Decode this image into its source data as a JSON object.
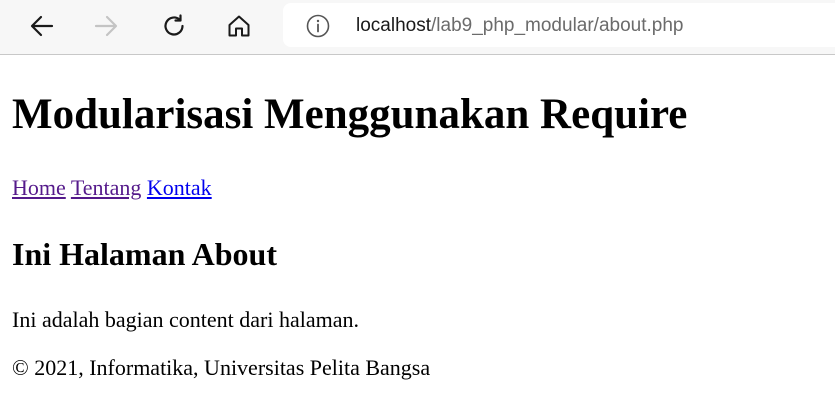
{
  "browser": {
    "icons": {
      "back": "arrow-left-icon",
      "forward": "arrow-right-icon",
      "reload": "reload-icon",
      "home": "home-icon",
      "site_info": "info-circle-icon"
    },
    "address": {
      "host": "localhost",
      "path": "/lab9_php_modular/about.php"
    }
  },
  "page": {
    "title": "Modularisasi Menggunakan Require",
    "nav": [
      {
        "label": "Home",
        "visited": true
      },
      {
        "label": "Tentang",
        "visited": true
      },
      {
        "label": "Kontak",
        "visited": false
      }
    ],
    "heading": "Ini Halaman About",
    "content": "Ini adalah bagian content dari halaman.",
    "footer": "© 2021, Informatika, Universitas Pelita Bangsa"
  },
  "colors": {
    "link_visited": "#551a8b",
    "link_unvisited": "#0000ee",
    "toolbar_bg": "#f7f7f7",
    "icon_active": "#1a1a1a",
    "icon_disabled": "#c4c4c4"
  }
}
